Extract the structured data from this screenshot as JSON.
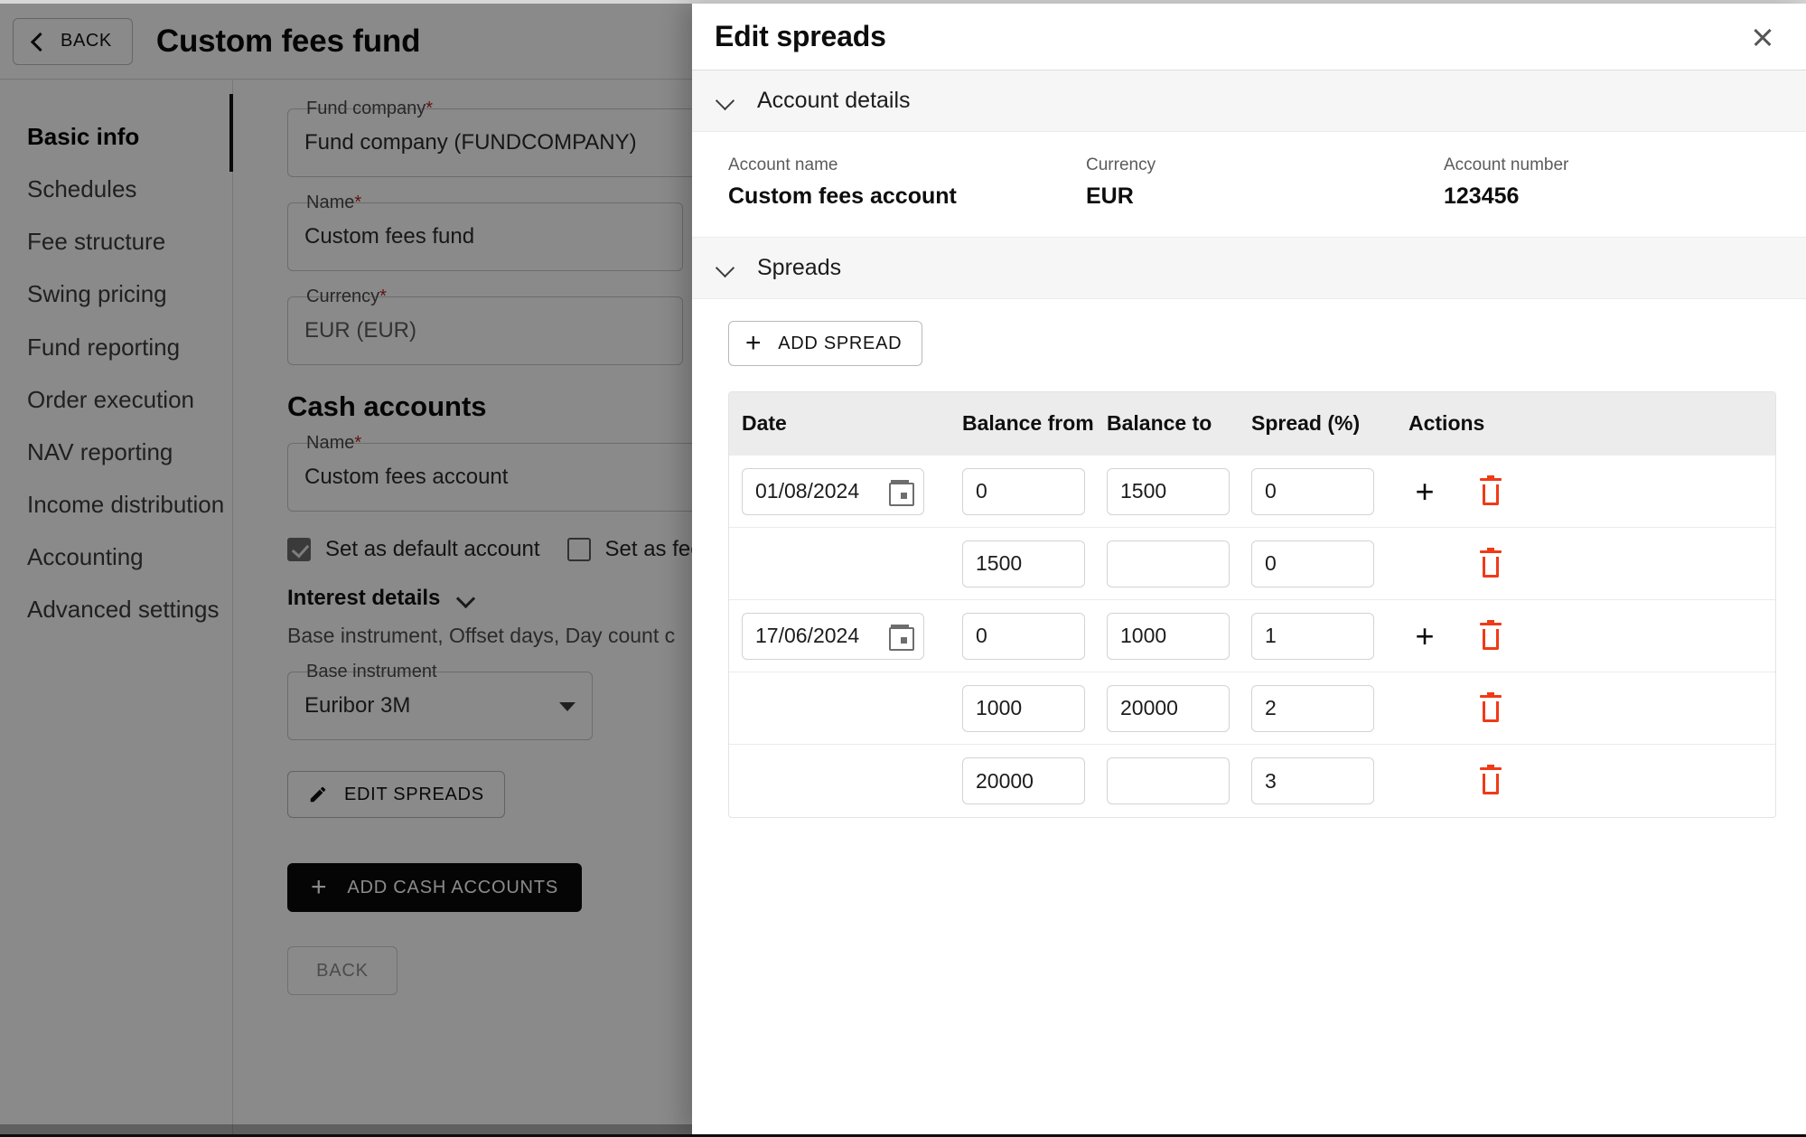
{
  "background": {
    "topbar": {
      "back_label": "BACK",
      "back_icon": "chevron-left-icon",
      "page_title": "Custom fees fund"
    },
    "sidebar": {
      "items": [
        {
          "label": "Basic info",
          "active": true
        },
        {
          "label": "Schedules",
          "active": false
        },
        {
          "label": "Fee structure",
          "active": false
        },
        {
          "label": "Swing pricing",
          "active": false
        },
        {
          "label": "Fund reporting",
          "active": false
        },
        {
          "label": "Order execution",
          "active": false
        },
        {
          "label": "NAV reporting",
          "active": false
        },
        {
          "label": "Income distribution",
          "active": false
        },
        {
          "label": "Accounting",
          "active": false
        },
        {
          "label": "Advanced settings",
          "active": false
        }
      ]
    },
    "form": {
      "fund_company_label": "Fund company",
      "fund_company_value": "Fund company (FUNDCOMPANY)",
      "name_label": "Name",
      "name_value": "Custom fees fund",
      "currency_label": "Currency",
      "currency_value": "EUR (EUR)",
      "cash_accounts_title": "Cash accounts",
      "account_name_label": "Name",
      "account_name_value": "Custom fees account",
      "checkbox_default_label": "Set as default account",
      "checkbox_fee_label": "Set as fee a",
      "interest_details_label": "Interest details",
      "interest_details_desc": "Base instrument, Offset days, Day count c",
      "base_instrument_label": "Base instrument",
      "base_instrument_value": "Euribor 3M",
      "edit_spreads_label": "EDIT SPREADS",
      "add_cash_accounts_label": "ADD CASH ACCOUNTS",
      "back_label": "BACK",
      "required_marker": "*"
    }
  },
  "modal": {
    "title": "Edit spreads",
    "close_icon": "close-icon",
    "account_details": {
      "section_label": "Account details",
      "fields": [
        {
          "label": "Account name",
          "value": "Custom fees account"
        },
        {
          "label": "Currency",
          "value": "EUR"
        },
        {
          "label": "Account number",
          "value": "123456"
        }
      ]
    },
    "spreads": {
      "section_label": "Spreads",
      "add_spread_label": "ADD SPREAD",
      "columns": [
        "Date",
        "Balance from",
        "Balance to",
        "Spread (%)",
        "Actions"
      ],
      "rows": [
        {
          "date": "01/08/2024",
          "balance_from": "0",
          "balance_to": "1500",
          "spread": "0",
          "has_add": true,
          "has_date": true
        },
        {
          "date": "",
          "balance_from": "1500",
          "balance_to": "",
          "spread": "0",
          "has_add": false,
          "has_date": false
        },
        {
          "date": "17/06/2024",
          "balance_from": "0",
          "balance_to": "1000",
          "spread": "1",
          "has_add": true,
          "has_date": true
        },
        {
          "date": "",
          "balance_from": "1000",
          "balance_to": "20000",
          "spread": "2",
          "has_add": false,
          "has_date": false
        },
        {
          "date": "",
          "balance_from": "20000",
          "balance_to": "",
          "spread": "3",
          "has_add": false,
          "has_date": false
        }
      ]
    }
  },
  "colors": {
    "accent_delete": "#f03a17",
    "required": "#b3261e",
    "dark_button": "#0a0a0a",
    "header_row": "#ececec",
    "section_header": "#f6f6f6"
  }
}
